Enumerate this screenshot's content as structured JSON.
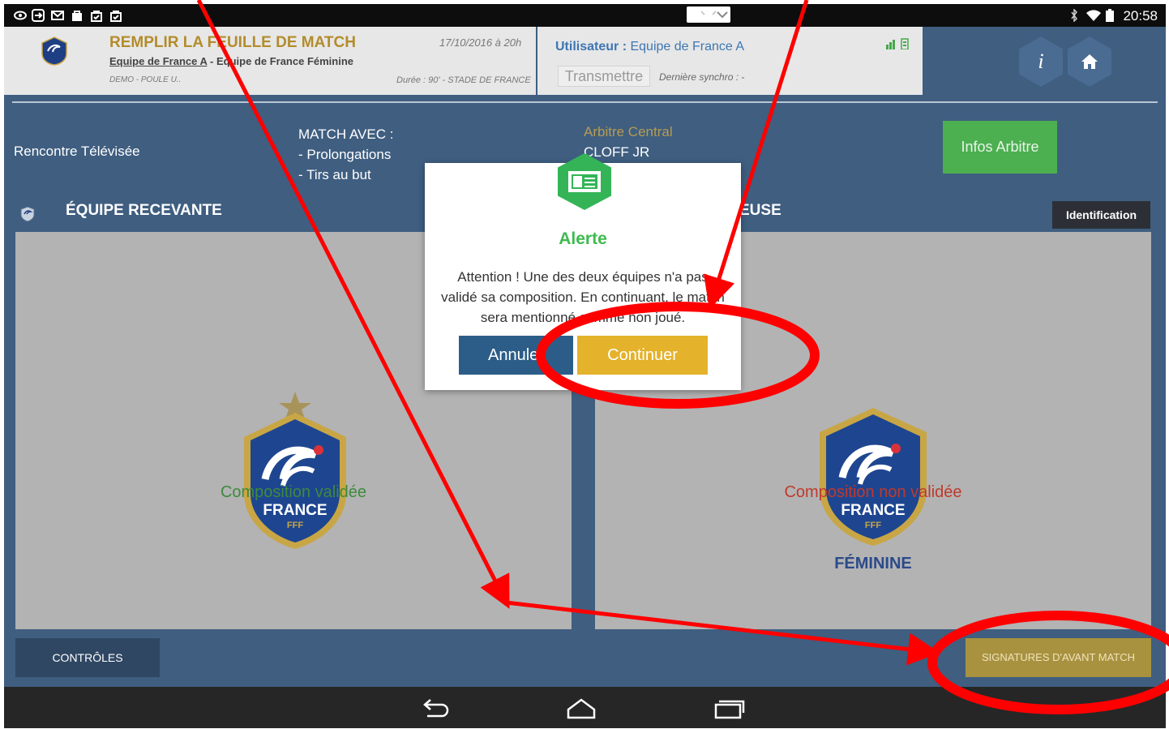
{
  "status_bar": {
    "time": "20:58",
    "left_icons": [
      "eye-icon",
      "remote-icon",
      "gmail-icon",
      "bag-icon",
      "bag-check-icon",
      "bag-check-icon"
    ],
    "right_icons": [
      "bluetooth-icon",
      "wifi-icon",
      "battery-icon"
    ]
  },
  "header": {
    "title": "REMPLIR LA FEUILLE DE MATCH",
    "date": "17/10/2016 à 20h",
    "home_team": "Equipe de France A",
    "separator": " - ",
    "away_team": "Equipe de France Féminine",
    "competition": "DEMO - POULE U..",
    "duration_venue": "Durée : 90' - STADE DE FRANCE",
    "user_label": "Utilisateur :",
    "user_value": "Equipe de France A",
    "transmit_label": "Transmettre",
    "synchro_label": "Dernière synchro : -",
    "info_button": "i",
    "home_button_icon": "home-icon"
  },
  "match_info": {
    "televised": "Rencontre Télévisée",
    "match_avec_title": "MATCH AVEC :",
    "match_avec_items": [
      "- Prolongations",
      "- Tirs au but"
    ],
    "referee_label": "Arbitre Central",
    "referee_name": "CLOFF JR",
    "referee_button": "Infos Arbitre"
  },
  "teams": {
    "home_heading": "ÉQUIPE RECEVANTE",
    "away_heading_visible": "EUSE",
    "identification_button": "Identification",
    "home_status": "Composition validée",
    "away_status": "Composition non validée",
    "away_crest_caption": "FÉMININE",
    "crest_text": "FRANCE",
    "crest_subtext": "FFF"
  },
  "footer": {
    "controls_button": "CONTRÔLES",
    "signatures_button": "SIGNATURES D'AVANT MATCH"
  },
  "dialog": {
    "title": "Alerte",
    "message": "Attention ! Une des deux équipes n'a pas validé sa composition. En continuant, le match sera mentionné comme non joué.",
    "cancel_label": "Annuler",
    "continue_label": "Continuer"
  },
  "colors": {
    "background": "#3f5e80",
    "header_bg": "#e7e7e7",
    "gold": "#b38c2b",
    "green": "#4caf50",
    "alert_green": "#3dbb4f",
    "continue_yellow": "#e4b22b",
    "annotation_red": "#ff0000"
  }
}
